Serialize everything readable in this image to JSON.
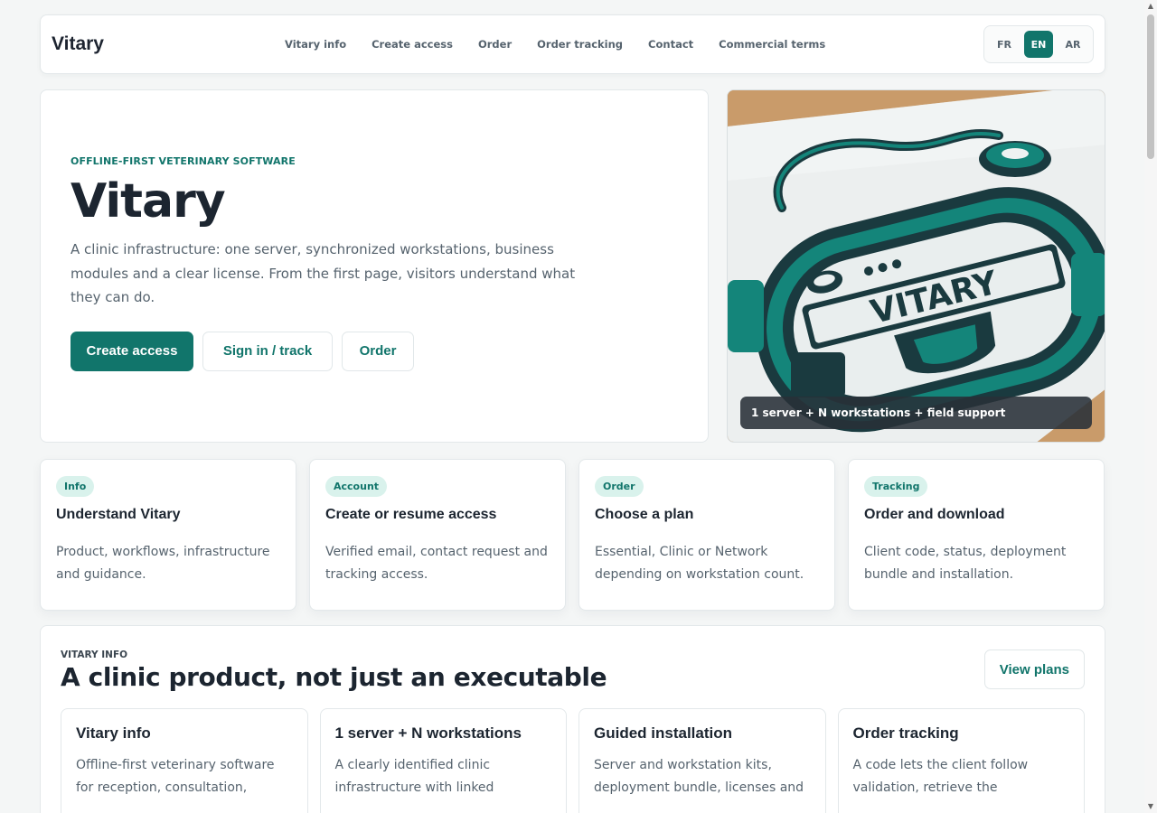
{
  "nav": {
    "brand": "Vitary",
    "links": [
      "Vitary info",
      "Create access",
      "Order",
      "Order tracking",
      "Contact",
      "Commercial terms"
    ],
    "langs": [
      "FR",
      "EN",
      "AR"
    ],
    "active_lang": "EN"
  },
  "hero": {
    "eyebrow": "OFFLINE-FIRST VETERINARY SOFTWARE",
    "title": "Vitary",
    "description": "A clinic infrastructure: one server, synchronized workstations, business modules and a clear license. From the first page, visitors understand what they can do.",
    "buttons": {
      "create": "Create access",
      "signin": "Sign in / track",
      "order": "Order"
    },
    "image_caption": "1 server + N workstations + field support",
    "image_word": "VITARY"
  },
  "cards": [
    {
      "tag": "Info",
      "title": "Understand Vitary",
      "desc": "Product, workflows, infrastructure and guidance."
    },
    {
      "tag": "Account",
      "title": "Create or resume access",
      "desc": "Verified email, contact request and tracking access."
    },
    {
      "tag": "Order",
      "title": "Choose a plan",
      "desc": "Essential, Clinic or Network depending on workstation count."
    },
    {
      "tag": "Tracking",
      "title": "Order and download",
      "desc": "Client code, status, deployment bundle and installation."
    }
  ],
  "info": {
    "eyebrow": "VITARY INFO",
    "title": "A clinic product, not just an executable",
    "button": "View plans",
    "cards": [
      {
        "title": "Vitary info",
        "desc": "Offline-first veterinary software for reception, consultation,"
      },
      {
        "title": "1 server + N workstations",
        "desc": "A clearly identified clinic infrastructure with linked"
      },
      {
        "title": "Guided installation",
        "desc": "Server and workstation kits, deployment bundle, licenses and"
      },
      {
        "title": "Order tracking",
        "desc": "A code lets the client follow validation, retrieve the"
      }
    ]
  },
  "colors": {
    "accent": "#11756b",
    "pill_bg": "#d9f2ec",
    "text": "#1c2530",
    "muted": "#56636e"
  }
}
